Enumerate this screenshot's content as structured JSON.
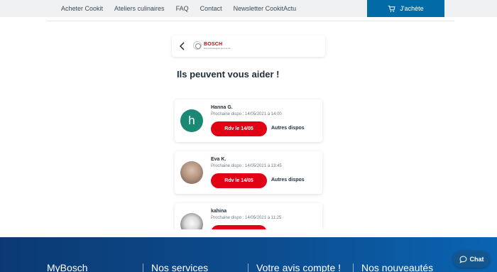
{
  "nav": {
    "links": [
      "Acheter Cookit",
      "Ateliers culinaires",
      "FAQ",
      "Contact",
      "Newsletter CookitActu"
    ],
    "buy_label": "J'achète"
  },
  "brand": {
    "name": "BOSCH",
    "tagline": "Des technologies pour la vie"
  },
  "page": {
    "heading": "Ils peuvent vous aider !"
  },
  "advisors": [
    {
      "name": "Hanna G.",
      "avatar_letter": "h",
      "dispo": "Prochaine dispo : 14/05/2021 à 14:00",
      "rdv_label": "Rdv le 14/05",
      "other_label": "Autres dispos"
    },
    {
      "name": "Eva K.",
      "avatar_letter": "",
      "dispo": "Prochaine dispo : 14/05/2021 à 13:45",
      "rdv_label": "Rdv le 14/05",
      "other_label": "Autres dispos"
    },
    {
      "name": "kahina",
      "avatar_letter": "",
      "dispo": "Prochaine dispo : 14/05/2021 à 11:25",
      "rdv_label": "",
      "other_label": ""
    }
  ],
  "footer": {
    "columns": [
      "MyBosch",
      "Nos services",
      "Votre avis compte !",
      "Nos nouveautés"
    ]
  },
  "chat": {
    "label": "Chat"
  },
  "colors": {
    "primary_blue": "#006ba6",
    "bosch_red": "#e20015",
    "avatar_green": "#1a8872"
  }
}
